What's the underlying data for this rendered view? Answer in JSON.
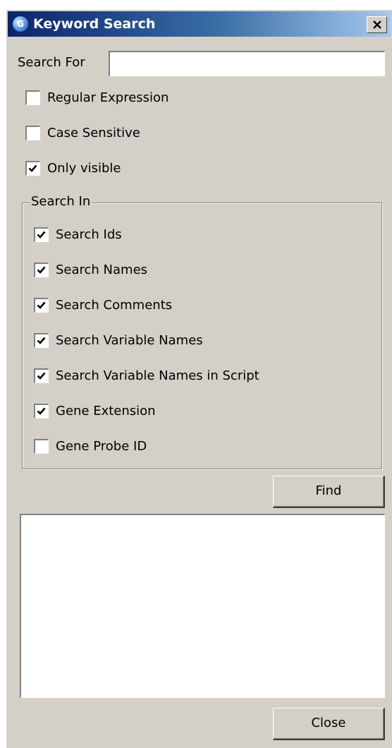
{
  "window": {
    "title": "Keyword Search",
    "icon": "app-logo-icon",
    "icon_glyph": "G",
    "close_icon": "close-icon"
  },
  "search_for": {
    "label": "Search For",
    "value": "",
    "placeholder": ""
  },
  "options": [
    {
      "label": "Regular Expression",
      "checked": false
    },
    {
      "label": "Case Sensitive",
      "checked": false
    },
    {
      "label": "Only visible",
      "checked": true
    }
  ],
  "search_in": {
    "title": "Search In",
    "items": [
      {
        "label": "Search Ids",
        "checked": true
      },
      {
        "label": "Search Names",
        "checked": true
      },
      {
        "label": "Search Comments",
        "checked": true
      },
      {
        "label": "Search Variable Names",
        "checked": true
      },
      {
        "label": "Search Variable Names in Script",
        "checked": true
      },
      {
        "label": "Gene Extension",
        "checked": true
      },
      {
        "label": "Gene Probe ID",
        "checked": false
      }
    ]
  },
  "find_button": {
    "label": "Find"
  },
  "results": [],
  "close_button": {
    "label": "Close"
  },
  "colors": {
    "dialog_bg": "#d4d0c8",
    "titlebar_start": "#0a246a",
    "titlebar_end": "#a6caf0",
    "title_text": "#ffffff"
  }
}
